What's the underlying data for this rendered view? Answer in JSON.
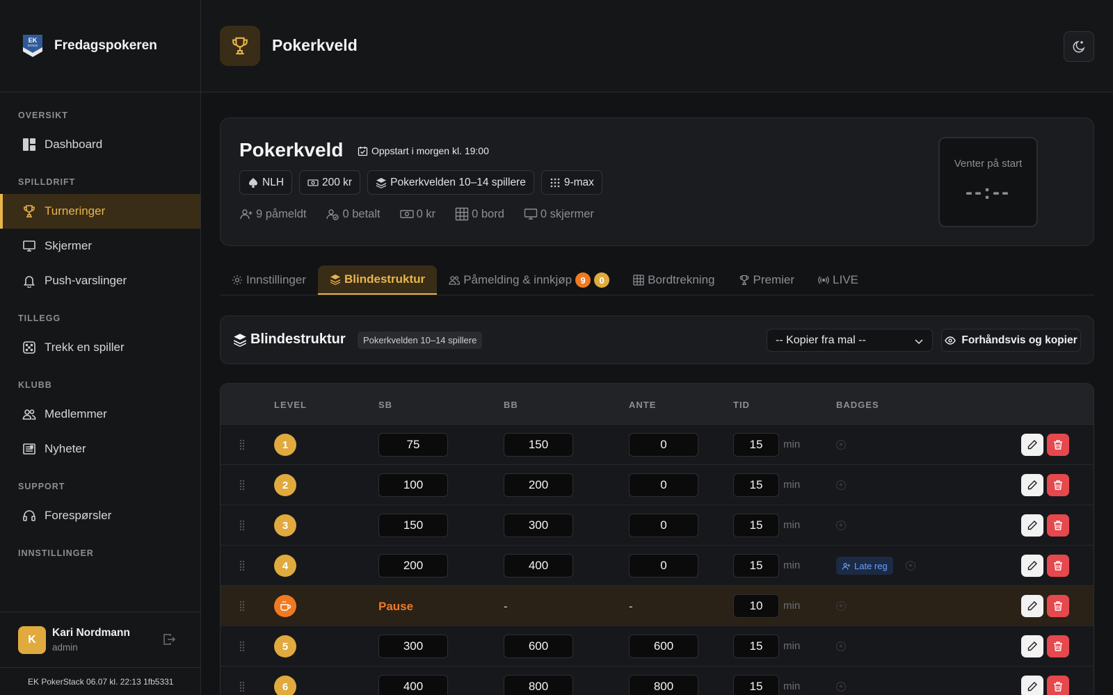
{
  "brand": {
    "name": "Fredagspokeren",
    "logo_text": "EK STACK"
  },
  "nav": {
    "sections": {
      "oversikt": "OVERSIKT",
      "spilldrift": "SPILLDRIFT",
      "tillegg": "TILLEGG",
      "klubb": "KLUBB",
      "support": "SUPPORT",
      "innstillinger": "INNSTILLINGER"
    },
    "items": {
      "dashboard": "Dashboard",
      "turneringer": "Turneringer",
      "skjermer": "Skjermer",
      "push": "Push-varslinger",
      "trekk": "Trekk en spiller",
      "medlemmer": "Medlemmer",
      "nyheter": "Nyheter",
      "foresporsler": "Forespørsler"
    }
  },
  "user": {
    "initial": "K",
    "name": "Kari Nordmann",
    "role": "admin"
  },
  "version": "EK PokerStack 06.07 kl. 22:13 1fb5331",
  "header": {
    "title": "Pokerkveld"
  },
  "tournament": {
    "title": "Pokerkveld",
    "start": "Oppstart i morgen kl. 19:00",
    "chips": {
      "game": "NLH",
      "buyin": "200 kr",
      "structure": "Pokerkvelden 10–14 spillere",
      "max": "9-max"
    },
    "stats": {
      "registered": "9 påmeldt",
      "paid": "0 betalt",
      "pot": "0 kr",
      "tables": "0 bord",
      "screens": "0 skjermer"
    },
    "timer": {
      "label": "Venter på start",
      "value": "--:--"
    }
  },
  "tabs": {
    "settings": "Innstillinger",
    "blinds": "Blindestruktur",
    "registration": "Påmelding & innkjøp",
    "registration_badge_a": "9",
    "registration_badge_b": "0",
    "tables": "Bordtrekning",
    "prizes": "Premier",
    "live": "LIVE"
  },
  "blinds": {
    "title": "Blindestruktur",
    "tag": "Pokerkvelden 10–14 spillere",
    "template_select": "-- Kopier fra mal --",
    "preview_button": "Forhåndsvis og kopier"
  },
  "table": {
    "headers": {
      "level": "LEVEL",
      "sb": "SB",
      "bb": "BB",
      "ante": "ANTE",
      "tid": "TID",
      "badges": "BADGES"
    },
    "min_label": "min",
    "pause_label": "Pause",
    "dash": "-",
    "late_reg": "Late reg",
    "rows": [
      {
        "level": "1",
        "sb": "75",
        "bb": "150",
        "ante": "0",
        "tid": "15"
      },
      {
        "level": "2",
        "sb": "100",
        "bb": "200",
        "ante": "0",
        "tid": "15"
      },
      {
        "level": "3",
        "sb": "150",
        "bb": "300",
        "ante": "0",
        "tid": "15"
      },
      {
        "level": "4",
        "sb": "200",
        "bb": "400",
        "ante": "0",
        "tid": "15"
      },
      {
        "level": "",
        "sb": "",
        "bb": "",
        "ante": "",
        "tid": "10"
      },
      {
        "level": "5",
        "sb": "300",
        "bb": "600",
        "ante": "600",
        "tid": "15"
      },
      {
        "level": "6",
        "sb": "400",
        "bb": "800",
        "ante": "800",
        "tid": "15"
      }
    ]
  },
  "colors": {
    "accent": "#e7b54c",
    "pause": "#f07a22",
    "danger": "#e5484d",
    "info": "#6aa0ff"
  }
}
